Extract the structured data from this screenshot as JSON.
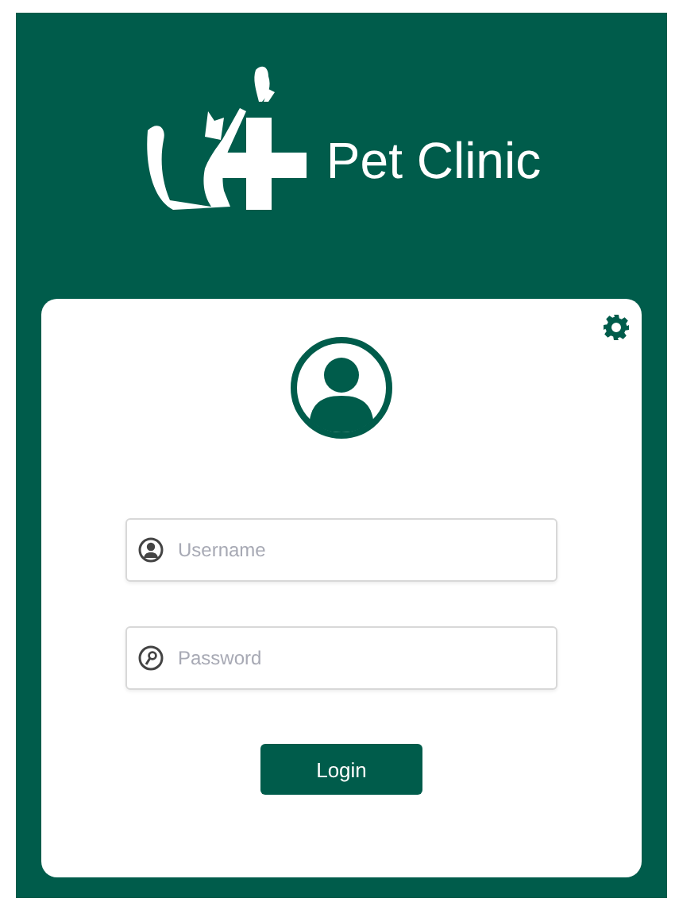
{
  "header": {
    "brand": "Pet Clinic"
  },
  "form": {
    "username": {
      "placeholder": "Username"
    },
    "password": {
      "placeholder": "Password"
    },
    "submit": "Login"
  }
}
